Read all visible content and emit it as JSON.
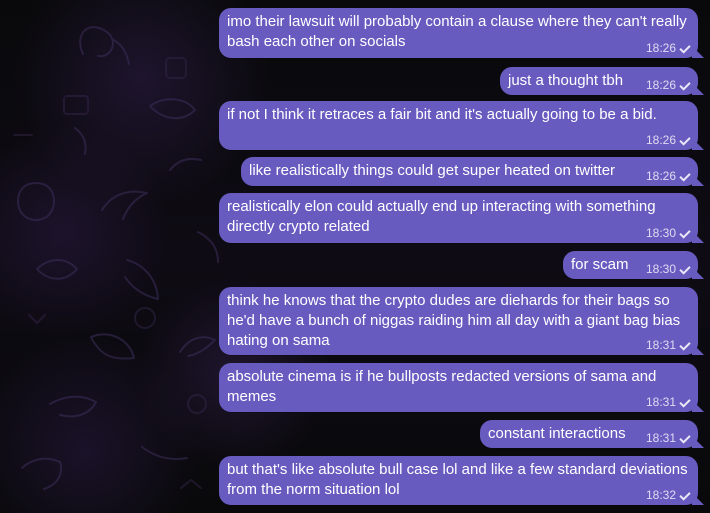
{
  "chat": {
    "messages": [
      {
        "text": "imo their lawsuit will probably contain a clause where they can't really bash each other on socials",
        "time": "18:26"
      },
      {
        "text": "just a thought tbh",
        "time": "18:26"
      },
      {
        "text": "if not I think it retraces a fair bit and it's actually going to be a bid.",
        "time": "18:26"
      },
      {
        "text": "like realistically things could get super heated on twitter",
        "time": "18:26"
      },
      {
        "text": "realistically elon could actually end up interacting with something directly crypto related",
        "time": "18:30"
      },
      {
        "text": "for scam",
        "time": "18:30"
      },
      {
        "text": "think he knows that the crypto dudes are diehards for their bags so he'd have a bunch of niggas raiding him all day with a giant bag bias hating on sama",
        "time": "18:31"
      },
      {
        "text": "absolute cinema is if he bullposts redacted versions of sama and memes",
        "time": "18:31"
      },
      {
        "text": "constant interactions",
        "time": "18:31"
      },
      {
        "text": "but that's like absolute bull case lol and like a few standard deviations from the norm situation lol",
        "time": "18:32"
      }
    ],
    "status_icon": "check-icon",
    "colors": {
      "bubble": "#675bc0",
      "background": "#0b0b0d",
      "text": "#ffffff"
    }
  }
}
